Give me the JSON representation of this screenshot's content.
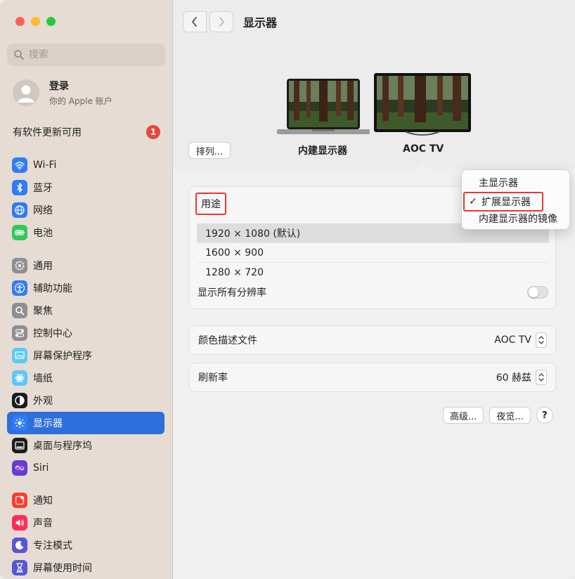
{
  "window": {
    "title": "显示器"
  },
  "sidebar": {
    "search_placeholder": "搜索",
    "account": {
      "title": "登录",
      "subtitle": "你的 Apple 账户"
    },
    "update": {
      "label": "有软件更新可用",
      "count": "1"
    },
    "groups": [
      [
        {
          "label": "Wi-Fi",
          "icon": "wifi-icon",
          "color": "#2f7cf6"
        },
        {
          "label": "蓝牙",
          "icon": "bluetooth-icon",
          "color": "#2f7cf6"
        },
        {
          "label": "网络",
          "icon": "globe-icon",
          "color": "#2f7cf6"
        },
        {
          "label": "电池",
          "icon": "battery-icon",
          "color": "#34c759"
        }
      ],
      [
        {
          "label": "通用",
          "icon": "gear-icon",
          "color": "#8e8e93"
        },
        {
          "label": "辅助功能",
          "icon": "accessibility-icon",
          "color": "#2f7cf6"
        },
        {
          "label": "聚焦",
          "icon": "spotlight-search-icon",
          "color": "#8e8e93"
        },
        {
          "label": "控制中心",
          "icon": "control-center-icon",
          "color": "#8e8e93"
        },
        {
          "label": "屏幕保护程序",
          "icon": "screensaver-icon",
          "color": "#5ac8fa"
        },
        {
          "label": "墙纸",
          "icon": "wallpaper-icon",
          "color": "#5ac8fa"
        },
        {
          "label": "外观",
          "icon": "appearance-icon",
          "color": "#1c1c1e"
        },
        {
          "label": "显示器",
          "icon": "display-brightness-icon",
          "color": "#2f7cf6",
          "active": true
        },
        {
          "label": "桌面与程序坞",
          "icon": "dock-icon",
          "color": "#1c1c1e"
        },
        {
          "label": "Siri",
          "icon": "siri-icon",
          "color": "#5e3fd1"
        }
      ],
      [
        {
          "label": "通知",
          "icon": "notification-icon",
          "color": "#ff3b30"
        },
        {
          "label": "声音",
          "icon": "sound-icon",
          "color": "#ff2d55"
        },
        {
          "label": "专注模式",
          "icon": "focus-moon-icon",
          "color": "#5856d6"
        },
        {
          "label": "屏幕使用时间",
          "icon": "hourglass-icon",
          "color": "#5856d6"
        }
      ]
    ]
  },
  "header": {
    "back_label": "‹",
    "forward_label": "›",
    "title": "显示器"
  },
  "displays": {
    "arrange_button": "排列...",
    "builtin_label": "内建显示器",
    "external_label": "AOC TV"
  },
  "usage": {
    "label": "用途",
    "resolutions": [
      "1920 × 1080 (默认)",
      "1600 × 900",
      "1280 × 720"
    ],
    "show_all_label": "显示所有分辨率"
  },
  "color_profile": {
    "label": "颜色描述文件",
    "value": "AOC TV"
  },
  "refresh_rate": {
    "label": "刷新率",
    "value": "60 赫兹"
  },
  "buttons": {
    "advanced": "高级...",
    "night_shift": "夜览...",
    "help": "?"
  },
  "usage_menu": {
    "items": [
      {
        "label": "主显示器",
        "checked": false
      },
      {
        "label": "扩展显示器",
        "checked": true
      },
      {
        "label": "内建显示器的镜像",
        "checked": false
      }
    ],
    "check_glyph": "✓",
    "highlight_color": "#e53935"
  }
}
